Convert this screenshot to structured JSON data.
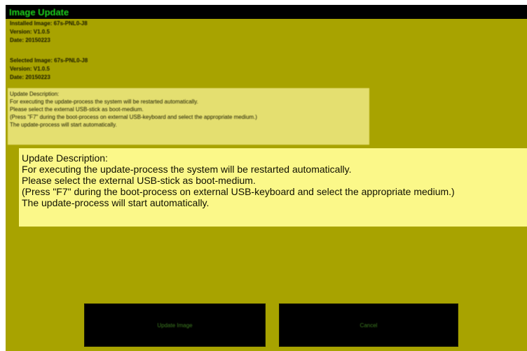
{
  "window": {
    "title": "Image Update"
  },
  "installed": {
    "image": "Installed Image: 67s-PNL0-J8",
    "version": "Version: V1.0.5",
    "date": "Date: 20150223"
  },
  "selected": {
    "image": "Selected Image: 67s-PNL0-J8",
    "version": "Version: V1.0.5",
    "date": "Date: 20150223"
  },
  "description": {
    "heading": "Update Description:",
    "lines": [
      "For executing the update-process the system will be restarted automatically.",
      "Please select the external USB-stick as boot-medium.",
      "(Press \"F7\" during the boot-process on external USB-keyboard and select the appropriate medium.)",
      "The update-process will start automatically."
    ]
  },
  "buttons": {
    "update_label": "Update Image",
    "cancel_label": "Cancel"
  },
  "colors": {
    "background": "#a8a300",
    "title_bar": "#000000",
    "title_text": "#1cd21c",
    "description_panel": "#fbf889",
    "button_background": "#000000",
    "button_text": "#3c7a20"
  }
}
